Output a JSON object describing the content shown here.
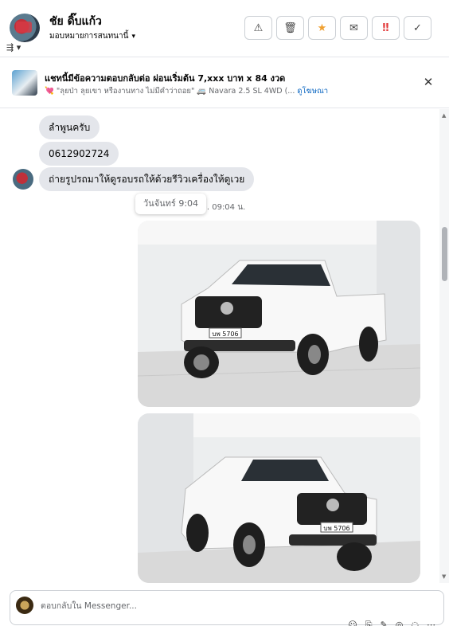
{
  "header": {
    "contact_name": "ชัย ดิ๊บแก้ว",
    "assign_label": "มอบหมายการสนทนานี้",
    "caret": "▾",
    "filter": "⇶ ▾",
    "actions": [
      {
        "name": "report-button",
        "icon": "⚠"
      },
      {
        "name": "delete-button",
        "icon": "🗑"
      },
      {
        "name": "star-button",
        "icon": "★"
      },
      {
        "name": "mail-button",
        "icon": "✉"
      },
      {
        "name": "spam-button",
        "icon": "‼"
      },
      {
        "name": "done-button",
        "icon": "✓"
      }
    ]
  },
  "ad": {
    "title": "แชทนี้มีข้อความตอบกลับต่อ ผ่อนเริ่มต้น 7,xxx บาท x 84 งวด",
    "heart": "💘",
    "subtitle": "\"ลุยป่า ลุยเขา หรืองานทาง ไม่มีคำว่าถอย\" 🚐 Navara 2.5 SL 4WD (...",
    "link": "ดูโฆษณา",
    "close": "✕"
  },
  "messages": {
    "m1": "ลำพูนครับ",
    "m2": "0612902724",
    "m3": "ถ่ายรูปรถมาให้ดูรอบรถให้ด้วยรีวิวเครื่องให้ดูเวย",
    "tooltip": "วันจันทร์ 9:04",
    "timestamp": "จ. 09:04 น.",
    "plate1": "บพ 5706",
    "plate2": "บพ 5706"
  },
  "scroll": {
    "up": "▲",
    "down": "▼"
  },
  "composer": {
    "placeholder": "ตอบกลับใน Messenger...",
    "tools": [
      "☺",
      "⎘",
      "✎",
      "◎",
      "◌",
      "⋯"
    ]
  }
}
